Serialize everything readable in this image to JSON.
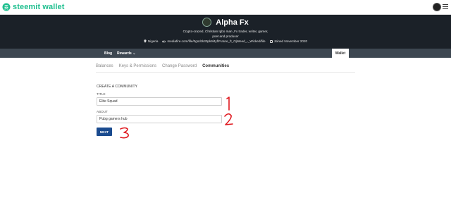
{
  "header": {
    "brand": "steemit wallet",
    "brand_color": "#1fbf8f"
  },
  "profile": {
    "name": "Alpha Fx",
    "about_line1": "Crypto-crazed, Christian Igbo man ,Fx trader, writer, gamer,",
    "about_line2": "poet and producer",
    "location": "Nigeria",
    "website": "mediafire.com/file/0gsdzk30pk9l4yf/Future_ft_OjWeed_-_Wicked/file",
    "joined": "Joined November 2020"
  },
  "nav": {
    "blog": "Blog",
    "rewards": "Rewards ⌄",
    "wallet": "Wallet"
  },
  "tabs": [
    {
      "label": "Balances"
    },
    {
      "label": "Keys & Permissions"
    },
    {
      "label": "Change Password"
    },
    {
      "label": "Communities"
    }
  ],
  "form": {
    "heading": "CREATE A COMMUNITY",
    "title_label": "TITLE",
    "title_value": "Elite Squad",
    "about_label": "ABOUT",
    "about_value": "Pubg gamers hub",
    "next_label": "NEXT",
    "button_color": "#1a4b8f"
  },
  "annotations": {
    "color": "#e0191f",
    "marks": [
      "1",
      "2",
      "3"
    ]
  }
}
